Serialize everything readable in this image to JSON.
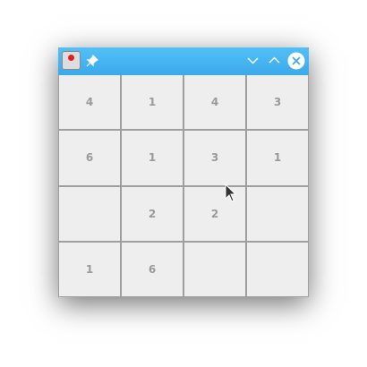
{
  "window": {
    "controls": {
      "minimize": "⌵",
      "maximize": "⌃",
      "close": "✕",
      "pin": "📌"
    }
  },
  "grid": {
    "cells": [
      "4",
      "1",
      "4",
      "3",
      "6",
      "1",
      "3",
      "1",
      "",
      "2",
      "2",
      "",
      "1",
      "6",
      "",
      ""
    ]
  }
}
